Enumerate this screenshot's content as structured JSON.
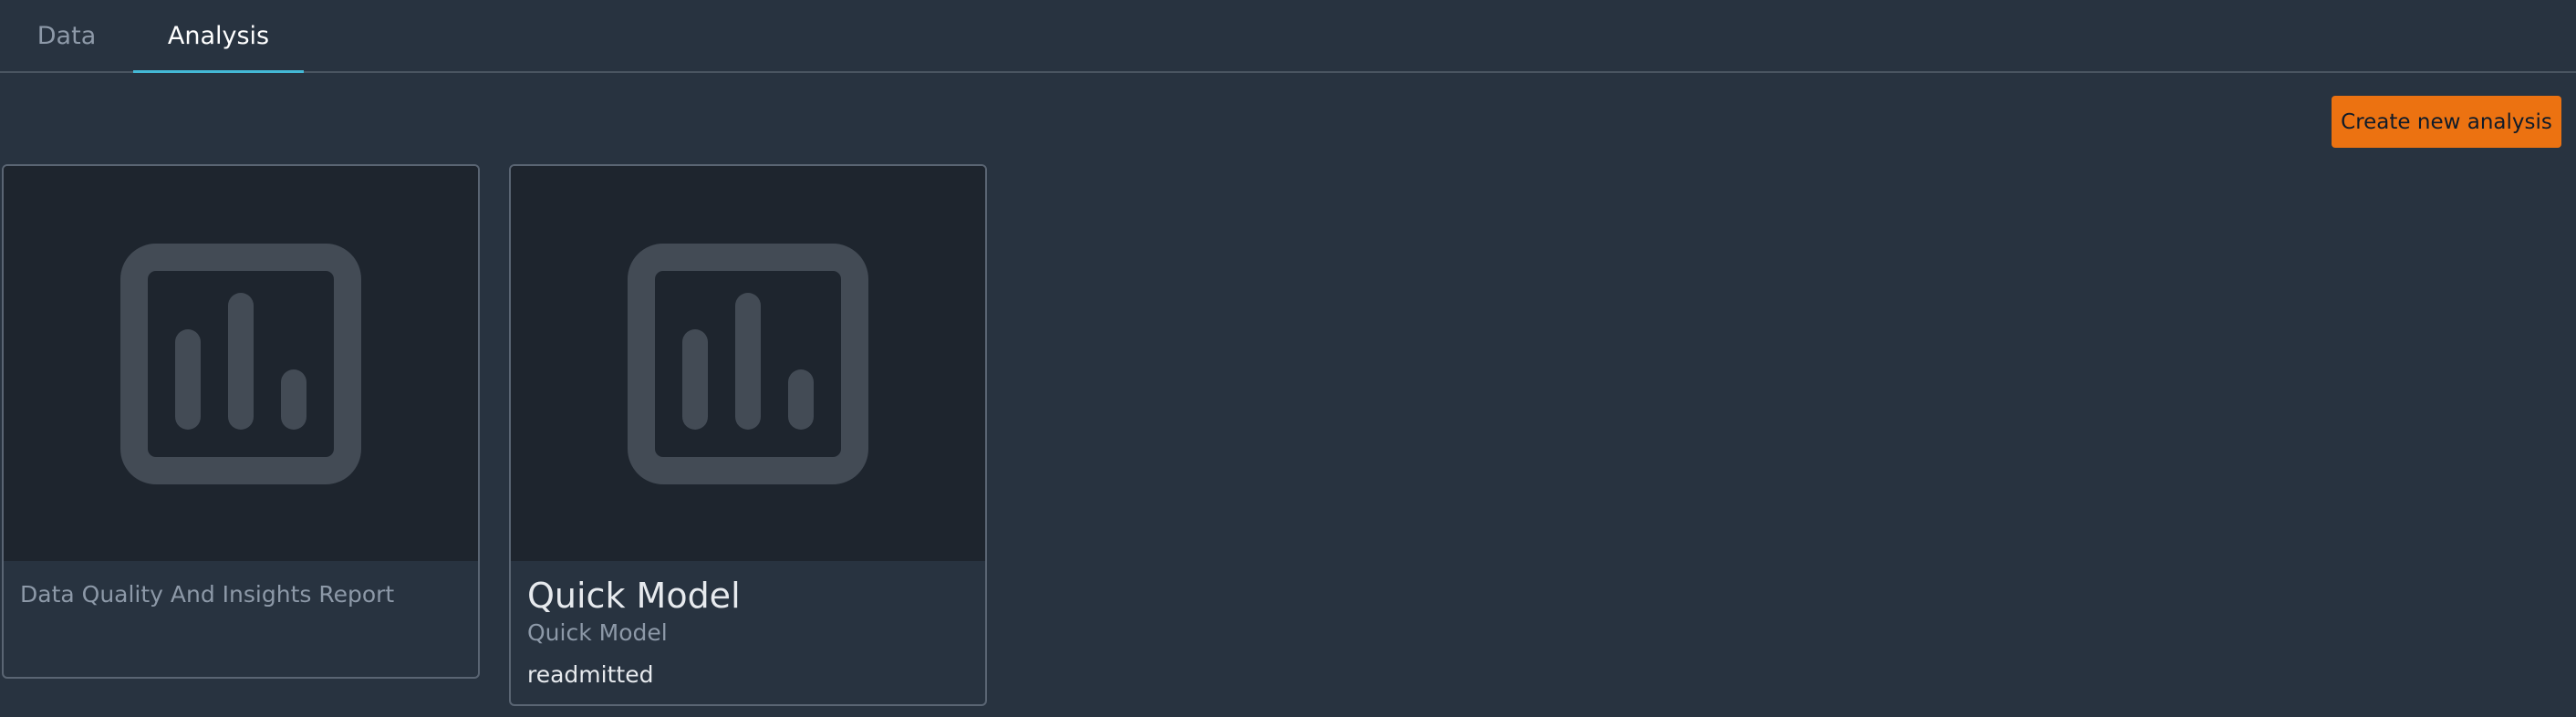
{
  "tabs": {
    "data_label": "Data",
    "analysis_label": "Analysis",
    "active": "Analysis"
  },
  "actions": {
    "create_label": "Create new analysis"
  },
  "cards": [
    {
      "icon": "bar-chart-icon",
      "name": "Data Quality And Insights Report"
    },
    {
      "icon": "bar-chart-icon",
      "title": "Quick Model",
      "subtitle": "Quick Model",
      "target": "readmitted"
    }
  ],
  "colors": {
    "background": "#283340",
    "thumbnail": "#1e252e",
    "accent_tab": "#44b9d6",
    "primary_button": "#ec7211"
  }
}
